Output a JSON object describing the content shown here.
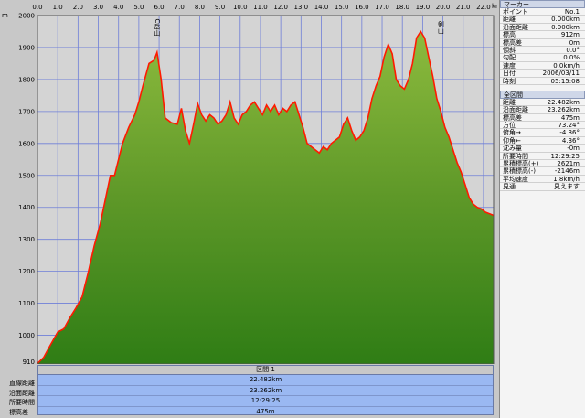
{
  "chart_data": {
    "type": "area",
    "unit_x": "km",
    "unit_y": "m",
    "xlim": [
      0,
      22.5
    ],
    "ylim": [
      910,
      2000
    ],
    "x_ticks": [
      0.0,
      1.0,
      2.0,
      3.0,
      4.0,
      5.0,
      6.0,
      7.0,
      8.0,
      9.0,
      10.0,
      11.0,
      12.0,
      13.0,
      14.0,
      15.0,
      16.0,
      17.0,
      18.0,
      19.0,
      20.0,
      21.0,
      22.0
    ],
    "x_tick_labels": [
      "0.0",
      "1.0",
      "2.0",
      "3.0",
      "4.0",
      "5.0",
      "6.0",
      "7.0",
      "8.0",
      "9.0",
      "10.0",
      "11.0",
      "12.0",
      "13.0",
      "14.0",
      "15.0",
      "16.0",
      "17.0",
      "18.0",
      "19.0",
      "20.0",
      "21.0",
      "22.0"
    ],
    "y_ticks": [
      1000,
      1100,
      1200,
      1300,
      1400,
      1500,
      1600,
      1700,
      1800,
      1900,
      2000
    ],
    "y_min_label": "910",
    "x": [
      0,
      0.3,
      0.6,
      1.0,
      1.3,
      1.6,
      1.9,
      2.2,
      2.5,
      2.8,
      3.1,
      3.4,
      3.6,
      3.8,
      4.2,
      4.5,
      4.8,
      5.0,
      5.2,
      5.5,
      5.75,
      5.9,
      6.1,
      6.3,
      6.6,
      6.9,
      7.1,
      7.3,
      7.5,
      7.7,
      7.9,
      8.1,
      8.3,
      8.5,
      8.7,
      8.9,
      9.1,
      9.3,
      9.5,
      9.7,
      9.9,
      10.1,
      10.3,
      10.5,
      10.7,
      10.9,
      11.1,
      11.3,
      11.5,
      11.7,
      11.9,
      12.1,
      12.3,
      12.5,
      12.7,
      12.9,
      13.1,
      13.3,
      13.5,
      13.7,
      13.9,
      14.1,
      14.3,
      14.5,
      14.7,
      14.9,
      15.1,
      15.3,
      15.5,
      15.7,
      15.9,
      16.1,
      16.3,
      16.5,
      16.7,
      16.9,
      17.1,
      17.3,
      17.5,
      17.7,
      17.9,
      18.1,
      18.3,
      18.5,
      18.7,
      18.9,
      19.1,
      19.3,
      19.5,
      19.7,
      19.9,
      20.1,
      20.3,
      20.5,
      20.7,
      20.9,
      21.1,
      21.3,
      21.5,
      21.7,
      21.9,
      22.1,
      22.3,
      22.5
    ],
    "y": [
      912,
      930,
      965,
      1010,
      1020,
      1055,
      1085,
      1120,
      1195,
      1280,
      1350,
      1440,
      1500,
      1500,
      1600,
      1650,
      1690,
      1730,
      1780,
      1850,
      1860,
      1885,
      1800,
      1680,
      1665,
      1660,
      1710,
      1640,
      1600,
      1660,
      1725,
      1690,
      1670,
      1690,
      1680,
      1660,
      1670,
      1690,
      1730,
      1680,
      1660,
      1690,
      1700,
      1720,
      1730,
      1710,
      1690,
      1720,
      1700,
      1720,
      1690,
      1710,
      1700,
      1720,
      1730,
      1690,
      1650,
      1600,
      1590,
      1580,
      1570,
      1590,
      1580,
      1600,
      1610,
      1620,
      1660,
      1680,
      1640,
      1610,
      1620,
      1640,
      1680,
      1740,
      1780,
      1810,
      1870,
      1910,
      1880,
      1800,
      1780,
      1770,
      1800,
      1850,
      1930,
      1950,
      1930,
      1870,
      1810,
      1740,
      1700,
      1650,
      1620,
      1580,
      1540,
      1510,
      1470,
      1430,
      1410,
      1400,
      1395,
      1385,
      1380,
      1375
    ],
    "annotations": [
      {
        "x": 5.9,
        "label": "C岳山"
      },
      {
        "x": 19.9,
        "label": "剣山"
      }
    ]
  },
  "summary": {
    "header": "区間 1",
    "rows": [
      {
        "label": "直線距離",
        "value": "22.482km"
      },
      {
        "label": "沿面距離",
        "value": "23.262km"
      },
      {
        "label": "所要時間",
        "value": "12:29:25"
      },
      {
        "label": "標高差",
        "value": "475m"
      }
    ]
  },
  "panel": {
    "marker": {
      "title": "マーカー",
      "rows": [
        {
          "k": "ポイント",
          "v": "No.1"
        },
        {
          "k": "距離",
          "v": "0.000km"
        },
        {
          "k": "沿面距離",
          "v": "0.000km"
        },
        {
          "k": "標高",
          "v": "912m"
        },
        {
          "k": "標高差",
          "v": "0m"
        },
        {
          "k": "傾斜",
          "v": "0.0°"
        },
        {
          "k": "勾配",
          "v": "0.0%"
        },
        {
          "k": "速度",
          "v": "0.0km/h"
        },
        {
          "k": "日付",
          "v": "2006/03/11"
        },
        {
          "k": "時刻",
          "v": "05:15:08"
        }
      ]
    },
    "all": {
      "title": "全区間",
      "rows": [
        {
          "k": "距離",
          "v": "22.482km"
        },
        {
          "k": "沿面距離",
          "v": "23.262km"
        },
        {
          "k": "標高差",
          "v": "475m"
        },
        {
          "k": "方位",
          "v": "73.24°"
        },
        {
          "k": "俯角→",
          "v": "-4.36°"
        },
        {
          "k": "仰角←",
          "v": "4.36°"
        },
        {
          "k": "沈み量",
          "v": "-0m"
        },
        {
          "k": "所要時間",
          "v": "12:29:25"
        },
        {
          "k": "累積標高(+)",
          "v": "2621m"
        },
        {
          "k": "累積標高(-)",
          "v": "-2146m"
        },
        {
          "k": "平均速度",
          "v": "1.8km/h"
        },
        {
          "k": "見通",
          "v": "見えます"
        }
      ]
    }
  }
}
